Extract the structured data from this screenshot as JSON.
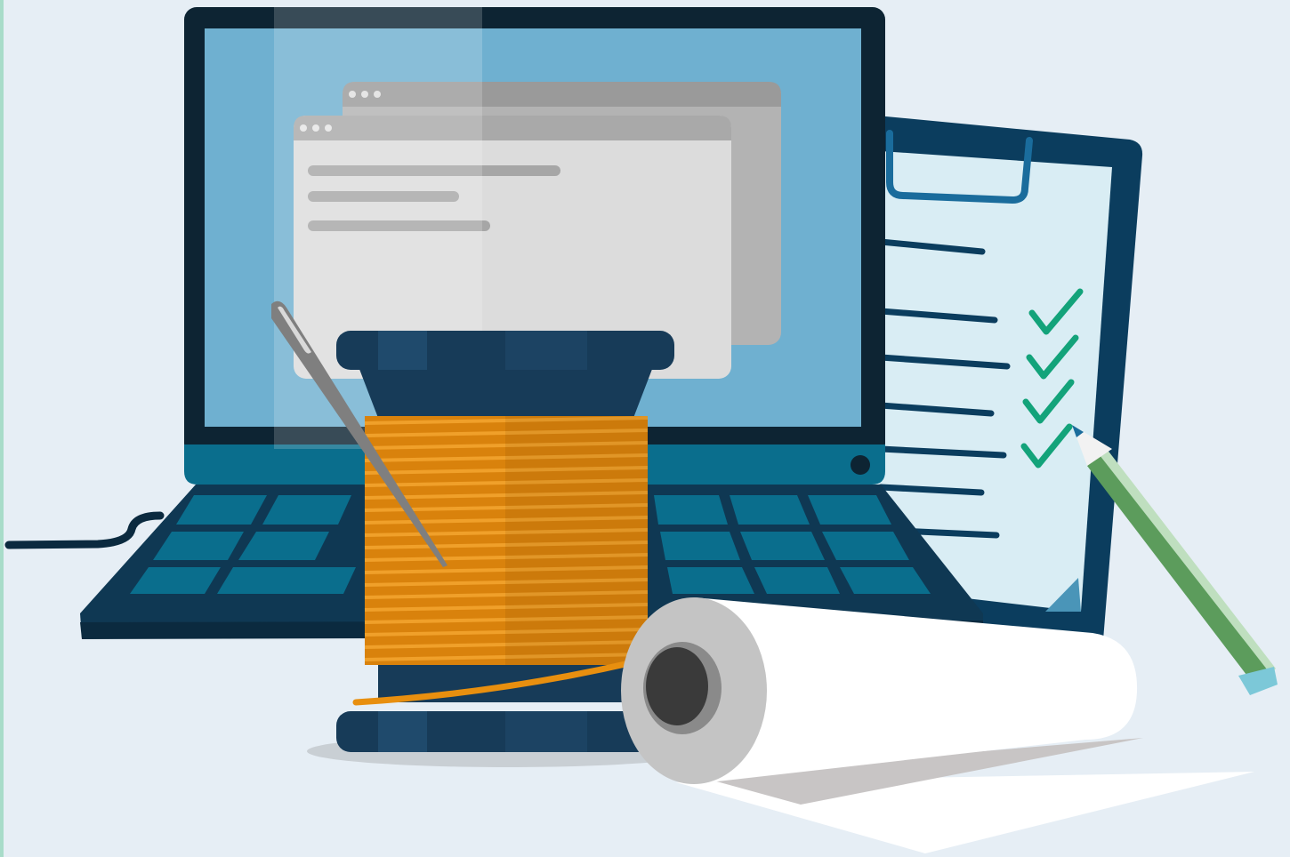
{
  "colors": {
    "background": "#e6eef5",
    "edge_strip": "#a8dcc9",
    "laptop_bezel": "#0d2433",
    "laptop_screen": "#6fb0d0",
    "laptop_base": "#0a6e8d",
    "keyboard_body": "#0f3853",
    "keyboard_keys": "#0a6e8d",
    "window_frame": "#bdbdbd",
    "window_body": "#dcdcdc",
    "clipboard_board": "#0b3d5e",
    "clipboard_paper": "#d9edf4",
    "check_marks": "#13a37a",
    "spool_body": "#173b58",
    "thread": "#e88f0f",
    "pencil_body": "#5c9c5c",
    "pencil_tip": "#bfe1ee",
    "paper_roll": "#ffffff",
    "roll_core": "#3a3a3a"
  },
  "icons": {
    "laptop": "laptop-icon",
    "browser_windows": "browser-window-icon",
    "clipboard": "clipboard-icon",
    "checklist": "check-icon",
    "thread_spool": "thread-spool-icon",
    "needle": "needle-icon",
    "pencil": "pencil-icon",
    "paper_roll": "paper-roll-icon"
  },
  "checklist": {
    "checked_items": 4,
    "total_lines": 7
  }
}
